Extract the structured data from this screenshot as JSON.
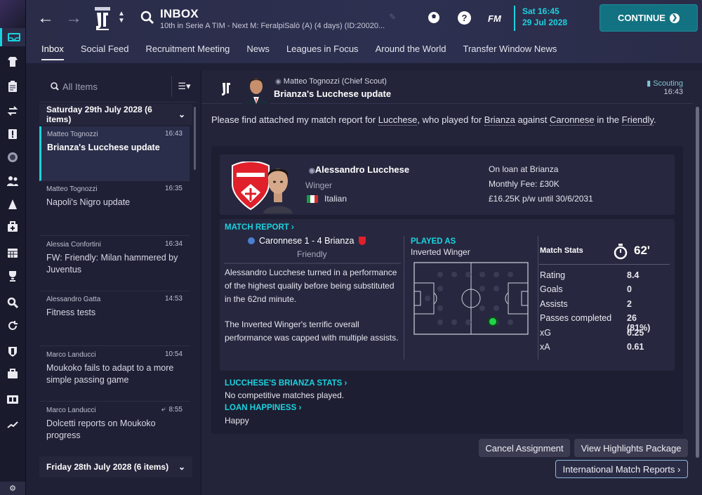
{
  "header": {
    "title": "INBOX",
    "subtitle": "10th in Serie A TIM - Next M: FeralpiSalò (A) (4 days) (ID:20020...",
    "time": "Sat 16:45",
    "date": "29 Jul 2028",
    "continue_label": "CONTINUE",
    "fm_label": "FM",
    "help_label": "?"
  },
  "tabs": [
    "Inbox",
    "Social Feed",
    "Recruitment Meeting",
    "News",
    "Leagues in Focus",
    "Around the World",
    "Transfer Window News"
  ],
  "search": {
    "placeholder": "All Items"
  },
  "groups": [
    {
      "label": "Saturday 29th July 2028 (6 items)"
    },
    {
      "label": "Friday 28th July 2028 (6 items)"
    }
  ],
  "messages": [
    {
      "from": "Matteo Tognozzi",
      "time": "16:43",
      "subject": "Brianza's Lucchese update"
    },
    {
      "from": "Matteo Tognozzi",
      "time": "16:35",
      "subject": "Napoli's Nigro update"
    },
    {
      "from": "Alessia Confortini",
      "time": "16:34",
      "subject": "FW: Friendly: Milan hammered by Juventus"
    },
    {
      "from": "Alessandro Gatta",
      "time": "14:53",
      "subject": "Fitness tests"
    },
    {
      "from": "Marco Landucci",
      "time": "10:54",
      "subject": "Moukoko fails to adapt to a more simple passing game"
    },
    {
      "from": "Marco Landucci",
      "time": "8:55",
      "subject": "Dolcetti reports on Moukoko progress"
    }
  ],
  "detail": {
    "sender": "Matteo Tognozzi  (Chief Scout)",
    "subject": "Brianza's Lucchese update",
    "tag": "Scouting",
    "time": "16:43",
    "intro_1": "Please find attached my match report for ",
    "intro_player": "Lucchese",
    "intro_2": ", who played for ",
    "intro_club": "Brianza",
    "intro_3": " against ",
    "intro_opp": "Caronnese",
    "intro_4": " in the ",
    "intro_comp": "Friendly",
    "intro_5": ".",
    "player": {
      "name": "Alessandro Lucchese",
      "position": "Winger",
      "nationality": "Italian",
      "loan": "On loan at Brianza",
      "fee": "Monthly Fee: £30K",
      "wage": "£16.25K p/w until 30/6/2031",
      "club_badge_text": "AC MONZA"
    },
    "match_report_label": "MATCH REPORT",
    "result": "Caronnese 1 - 4 Brianza",
    "competition": "Friendly",
    "report_p1": "Alessandro Lucchese turned in a performance of the highest quality before being substituted in the 62nd minute.",
    "report_p2": "The Inverted Winger's terrific overall performance was capped with multiple assists.",
    "played_as_label": "PLAYED AS",
    "played_as": "Inverted Winger",
    "stats_title": "Match Stats",
    "minutes": "62'",
    "stats": [
      {
        "label": "Rating",
        "value": "8.4"
      },
      {
        "label": "Goals",
        "value": "0"
      },
      {
        "label": "Assists",
        "value": "2"
      },
      {
        "label": "Passes completed",
        "value": "26 (81%)"
      },
      {
        "label": "xG",
        "value": "0.25"
      },
      {
        "label": "xA",
        "value": "0.61"
      }
    ],
    "stats_link": "LUCCHESE'S BRIANZA STATS",
    "stats_text": "No competitive matches played.",
    "happiness_link": "LOAN HAPPINESS",
    "happiness": "Happy"
  },
  "buttons": {
    "cancel": "Cancel Assignment",
    "highlights": "View Highlights Package",
    "international": "International Match Reports"
  },
  "colors": {
    "accent": "#1bd3e0",
    "continue": "#137281",
    "background": "#1f2035",
    "player_dot": "#21d34a"
  }
}
